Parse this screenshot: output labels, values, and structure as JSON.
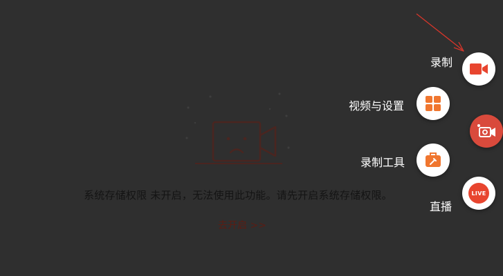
{
  "colors": {
    "background": "#2f2f2f",
    "accent_red": "#e8452f",
    "accent_orange": "#f0762f",
    "illustration": "#4a2520"
  },
  "empty_state": {
    "icon": "sad-camera-icon",
    "message": "系统存储权限 未开启，无法使用此功能。请先开启系统存储权限。",
    "enable_link": "去开启 >>"
  },
  "fab_menu": {
    "items": [
      {
        "label": "录制",
        "icon": "video-camera-icon"
      },
      {
        "label": "视频与设置",
        "icon": "grid-icon"
      },
      {
        "label": "录制工具",
        "icon": "toolbox-icon"
      },
      {
        "label": "直播",
        "icon": "live-icon",
        "badge": "LIVE"
      }
    ],
    "main_button_icon": "record-camera-icon"
  }
}
